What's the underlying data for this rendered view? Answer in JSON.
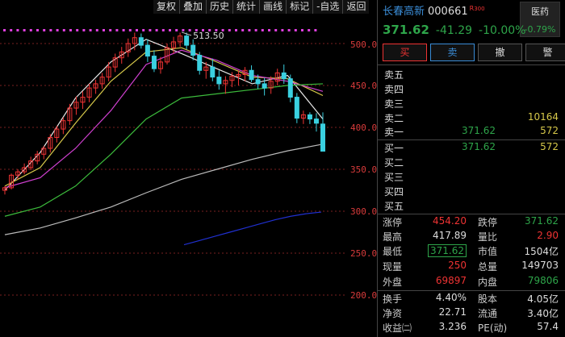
{
  "toolbar": [
    "复权",
    "叠加",
    "历史",
    "统计",
    "画线",
    "标记",
    "-自选",
    "返回"
  ],
  "chart": {
    "y_axis_labels": [
      "500.0",
      "450.0",
      "400.0",
      "350.0",
      "300.0",
      "250.0",
      "200.0"
    ],
    "high_annotation": "513.50"
  },
  "chart_data": {
    "type": "candlestick",
    "y_range": [
      180,
      525
    ],
    "y_ticks": [
      200,
      250,
      300,
      350,
      400,
      450,
      500
    ],
    "y_tick_labels": [
      "200.0",
      "250.0",
      "300.0",
      "350.0",
      "400.0",
      "450.0",
      "500.0"
    ],
    "high_label": "513.50",
    "candles_ohlc": [
      [
        325,
        330,
        320,
        328
      ],
      [
        328,
        345,
        326,
        343
      ],
      [
        343,
        350,
        338,
        347
      ],
      [
        347,
        357,
        344,
        352
      ],
      [
        352,
        365,
        349,
        360
      ],
      [
        360,
        372,
        356,
        368
      ],
      [
        368,
        378,
        362,
        375
      ],
      [
        375,
        392,
        370,
        388
      ],
      [
        388,
        402,
        382,
        398
      ],
      [
        398,
        412,
        392,
        408
      ],
      [
        408,
        428,
        403,
        423
      ],
      [
        423,
        437,
        415,
        430
      ],
      [
        430,
        443,
        422,
        436
      ],
      [
        436,
        452,
        430,
        447
      ],
      [
        447,
        457,
        440,
        452
      ],
      [
        452,
        465,
        446,
        460
      ],
      [
        460,
        478,
        455,
        472
      ],
      [
        472,
        488,
        466,
        483
      ],
      [
        483,
        496,
        476,
        490
      ],
      [
        490,
        506,
        484,
        500
      ],
      [
        500,
        513,
        492,
        507
      ],
      [
        507,
        512,
        494,
        498
      ],
      [
        498,
        505,
        478,
        485
      ],
      [
        485,
        492,
        466,
        470
      ],
      [
        470,
        484,
        464,
        478
      ],
      [
        478,
        500,
        475,
        495
      ],
      [
        495,
        508,
        488,
        502
      ],
      [
        502,
        513,
        496,
        509
      ],
      [
        509,
        513,
        493,
        498
      ],
      [
        498,
        505,
        480,
        486
      ],
      [
        486,
        490,
        463,
        468
      ],
      [
        468,
        478,
        458,
        472
      ],
      [
        472,
        482,
        455,
        460
      ],
      [
        460,
        468,
        445,
        452
      ],
      [
        452,
        461,
        440,
        456
      ],
      [
        456,
        466,
        448,
        461
      ],
      [
        461,
        468,
        450,
        463
      ],
      [
        463,
        472,
        455,
        468
      ],
      [
        468,
        474,
        454,
        457
      ],
      [
        457,
        463,
        446,
        452
      ],
      [
        452,
        459,
        438,
        447
      ],
      [
        447,
        461,
        440,
        455
      ],
      [
        455,
        470,
        450,
        465
      ],
      [
        465,
        475,
        452,
        458
      ],
      [
        458,
        463,
        430,
        436
      ],
      [
        436,
        441,
        405,
        411
      ],
      [
        411,
        420,
        404,
        415
      ],
      [
        415,
        418,
        404,
        410
      ],
      [
        410,
        417,
        395,
        405
      ],
      [
        404,
        417.89,
        371.62,
        371.62
      ]
    ],
    "ma_lines": {
      "white_ma5_approx": [
        325,
        370,
        435,
        478,
        505,
        488,
        470,
        452,
        462,
        410
      ],
      "yellow_ma10_approx": [
        330,
        352,
        405,
        455,
        490,
        495,
        478,
        460,
        458,
        438
      ],
      "magenta_ma20_approx": [
        328,
        340,
        375,
        420,
        475,
        492,
        480,
        462,
        455,
        443
      ],
      "green_ma60_approx": [
        294,
        305,
        330,
        368,
        410,
        435,
        440,
        445,
        450,
        452
      ],
      "gray_ma120_approx": [
        272,
        280,
        292,
        305,
        322,
        338,
        350,
        362,
        372,
        380
      ],
      "blue_ma250_approx": [
        260,
        265,
        270,
        275,
        280,
        285,
        290,
        294,
        297,
        299
      ]
    }
  },
  "header": {
    "name": "长春高新",
    "code": "000661",
    "r_tag": "R",
    "r_num": "300",
    "sector_name": "医药",
    "sector_pct": "-0.79%",
    "price": "371.62",
    "change": "-41.29",
    "change_pct": "-10.00%"
  },
  "buttons": {
    "buy": "买",
    "sell": "卖",
    "cancel": "撤",
    "alert": "警"
  },
  "orderbook": {
    "sell": [
      {
        "label": "卖五",
        "price": "",
        "vol": ""
      },
      {
        "label": "卖四",
        "price": "",
        "vol": ""
      },
      {
        "label": "卖三",
        "price": "",
        "vol": ""
      },
      {
        "label": "卖二",
        "price": "",
        "vol": "10164"
      },
      {
        "label": "卖一",
        "price": "371.62",
        "vol": "572"
      }
    ],
    "buy": [
      {
        "label": "买一",
        "price": "371.62",
        "vol": "572"
      },
      {
        "label": "买二",
        "price": "",
        "vol": ""
      },
      {
        "label": "买三",
        "price": "",
        "vol": ""
      },
      {
        "label": "买四",
        "price": "",
        "vol": ""
      },
      {
        "label": "买五",
        "price": "",
        "vol": ""
      }
    ]
  },
  "stats": [
    {
      "l1": "涨停",
      "v1": "454.20",
      "c1": "red",
      "l2": "跌停",
      "v2": "371.62",
      "c2": "green"
    },
    {
      "l1": "最高",
      "v1": "417.89",
      "c1": "white",
      "l2": "量比",
      "v2": "2.90",
      "c2": "red"
    },
    {
      "l1": "最低",
      "v1": "371.62",
      "c1": "green",
      "l2": "市值",
      "v2": "1504亿",
      "c2": "white"
    },
    {
      "l1": "现量",
      "v1": "250",
      "c1": "red",
      "l2": "总量",
      "v2": "149703",
      "c2": "white"
    },
    {
      "l1": "外盘",
      "v1": "69897",
      "c1": "red",
      "l2": "内盘",
      "v2": "79806",
      "c2": "green"
    }
  ],
  "stats2": [
    {
      "l1": "换手",
      "v1": "4.40%",
      "c1": "white",
      "l2": "股本",
      "v2": "4.05亿",
      "c2": "white"
    },
    {
      "l1": "净资",
      "v1": "22.71",
      "c1": "white",
      "l2": "流通",
      "v2": "3.40亿",
      "c2": "white"
    },
    {
      "l1": "收益㈡",
      "v1": "3.236",
      "c1": "white",
      "l2": "PE(动)",
      "v2": "57.4",
      "c2": "white"
    }
  ],
  "colors": {
    "up": "#e33",
    "down": "#2ea54a",
    "accent": "#3a8cd6"
  }
}
